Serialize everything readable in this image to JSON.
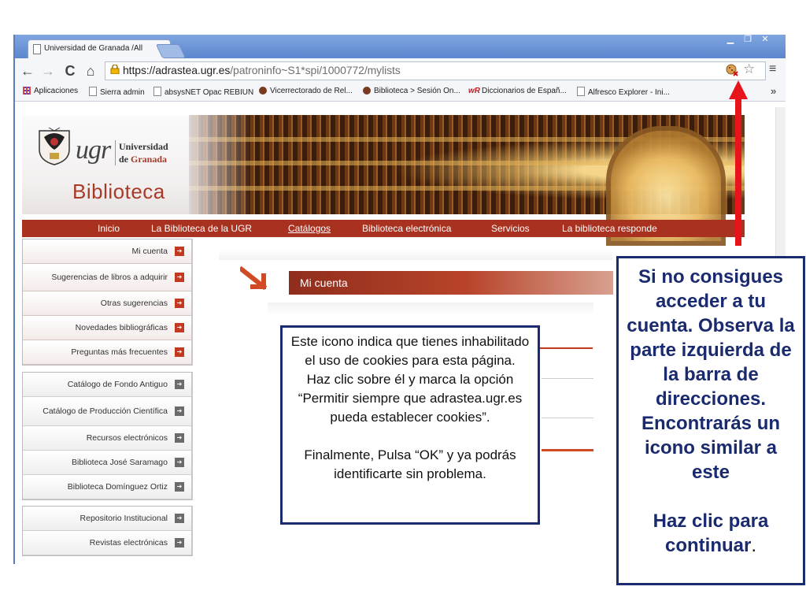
{
  "browser": {
    "tab_title": "Universidad de Granada /All",
    "tab_close": "×",
    "window_controls": [
      "▁",
      "❐",
      "✕"
    ],
    "url_host": "https://adrastea.ugr.es",
    "url_path": "/patroninfo~S1*spi/1000772/mylists",
    "nav": {
      "back": "←",
      "forward": "→",
      "reload": "C",
      "home": "⌂"
    },
    "star": "☆",
    "menu": "≡",
    "bookmarks": [
      {
        "label": "Aplicaciones",
        "icon": "apps-icon"
      },
      {
        "label": "Sierra admin",
        "icon": "page-icon"
      },
      {
        "label": "absysNET Opac REBIUN",
        "icon": "page-icon"
      },
      {
        "label": "Vicerrectorado de Rel...",
        "icon": "crest-icon"
      },
      {
        "label": "Biblioteca > Sesión On...",
        "icon": "crest-icon"
      },
      {
        "label": "Diccionarios de Españ...",
        "icon": "wr-icon",
        "prefix": "wR"
      },
      {
        "label": "Alfresco Explorer - Ini...",
        "icon": "page-icon"
      }
    ],
    "bookmarks_overflow": "»"
  },
  "site": {
    "logo_ugr": "ugr",
    "logo_line1": "Universidad",
    "logo_line2_de": "de ",
    "logo_line2_gr": "Granada",
    "biblioteca": "Biblioteca",
    "nav": [
      {
        "label": "Inicio",
        "active": false
      },
      {
        "label": "La Biblioteca de la UGR",
        "active": false
      },
      {
        "label": "Catálogos",
        "active": true
      },
      {
        "label": "Biblioteca electrónica",
        "active": false
      },
      {
        "label": "Servicios",
        "active": false
      },
      {
        "label": "La biblioteca responde",
        "active": false
      }
    ]
  },
  "sidebar": {
    "group1": [
      "Mi cuenta",
      "Sugerencias de libros a adquirir",
      "Otras sugerencias",
      "Novedades bibliográficas",
      "Preguntas más frecuentes"
    ],
    "group2": [
      "Catálogo de Fondo Antiguo",
      "Catálogo de Producción Científica",
      "Recursos electrónicos",
      "Biblioteca José Saramago",
      "Biblioteca Domínguez Ortiz"
    ],
    "group3": [
      "Repositorio Institucional",
      "Revistas electrónicas"
    ],
    "arrow_glyph": "➔"
  },
  "main": {
    "heading": "Mi cuenta"
  },
  "callout_small": {
    "line1": "Este icono indica que tienes inhabilitado el uso de cookies para esta página.",
    "line2": "Haz clic sobre él y marca la opción “Permitir siempre que adrastea.ugr.es pueda establecer cookies”.",
    "line3": "Finalmente, Pulsa “OK” y ya podrás identificarte sin problema."
  },
  "callout_big": {
    "text1": "Si no consigues acceder a tu cuenta. Observa la parte izquierda de la barra de direcciones. Encontrarás un icono similar a este",
    "text2": "Haz clic para continuar",
    "text2_tail": "."
  },
  "colors": {
    "brand_red": "#a8321f",
    "callout_border": "#1a2a6e",
    "arrow_red": "#e8141c"
  }
}
